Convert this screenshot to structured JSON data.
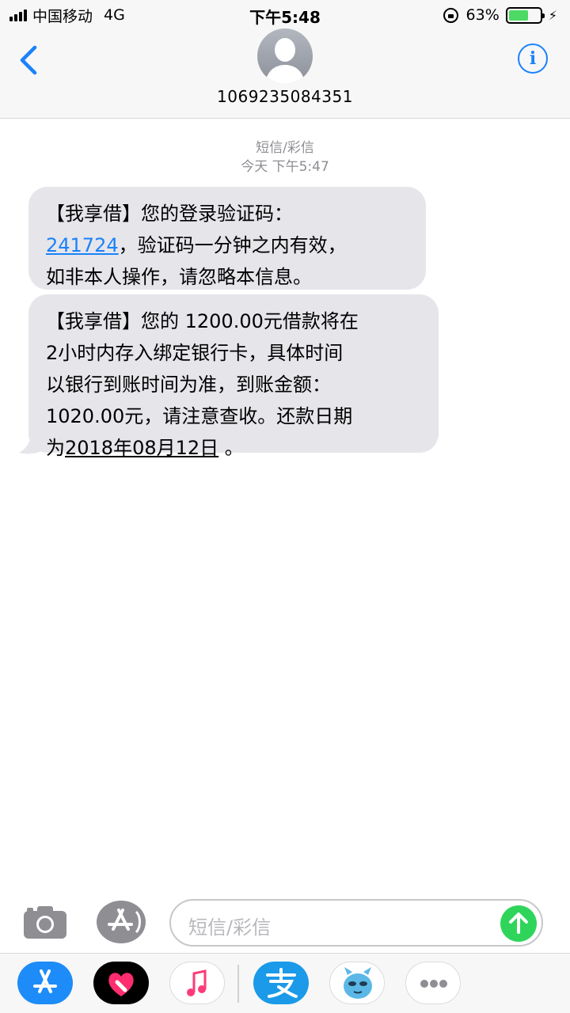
{
  "status_bar": {
    "carrier": "中国移动",
    "network": "4G",
    "time": "下午5:48",
    "battery_percent": "63%",
    "battery_level": 0.63
  },
  "header": {
    "contact": "1069235084351",
    "info_label": "i"
  },
  "conversation": {
    "service_label": "短信/彩信",
    "timestamp": "今天 下午5:47",
    "messages": [
      {
        "line1": "【我享借】您的登录验证码：",
        "code": "241724",
        "line2_rest": "，验证码一分钟之内有效，",
        "line3": "如非本人操作，请忽略本信息。"
      },
      {
        "line1": "【我享借】您的 1200.00元借款将在",
        "line2": "2小时内存入绑定银行卡，具体时间",
        "line3": "以银行到账时间为准，到账金额：",
        "line4": "1020.00元，请注意查收。还款日期",
        "line5_prefix": "为",
        "date": "2018年08月12日",
        "line5_suffix": " 。"
      }
    ]
  },
  "input": {
    "placeholder": "短信/彩信"
  },
  "app_drawer": {
    "apps": [
      "app-store-icon",
      "heart-digital-touch-icon",
      "music-icon",
      "alipay-icon",
      "cartoon-sticker-icon",
      "more-icon"
    ]
  },
  "colors": {
    "accent_blue": "#1a82fb",
    "bubble_gray": "#e5e5ea",
    "send_green": "#2fd55b",
    "battery_green": "#4cd964"
  }
}
